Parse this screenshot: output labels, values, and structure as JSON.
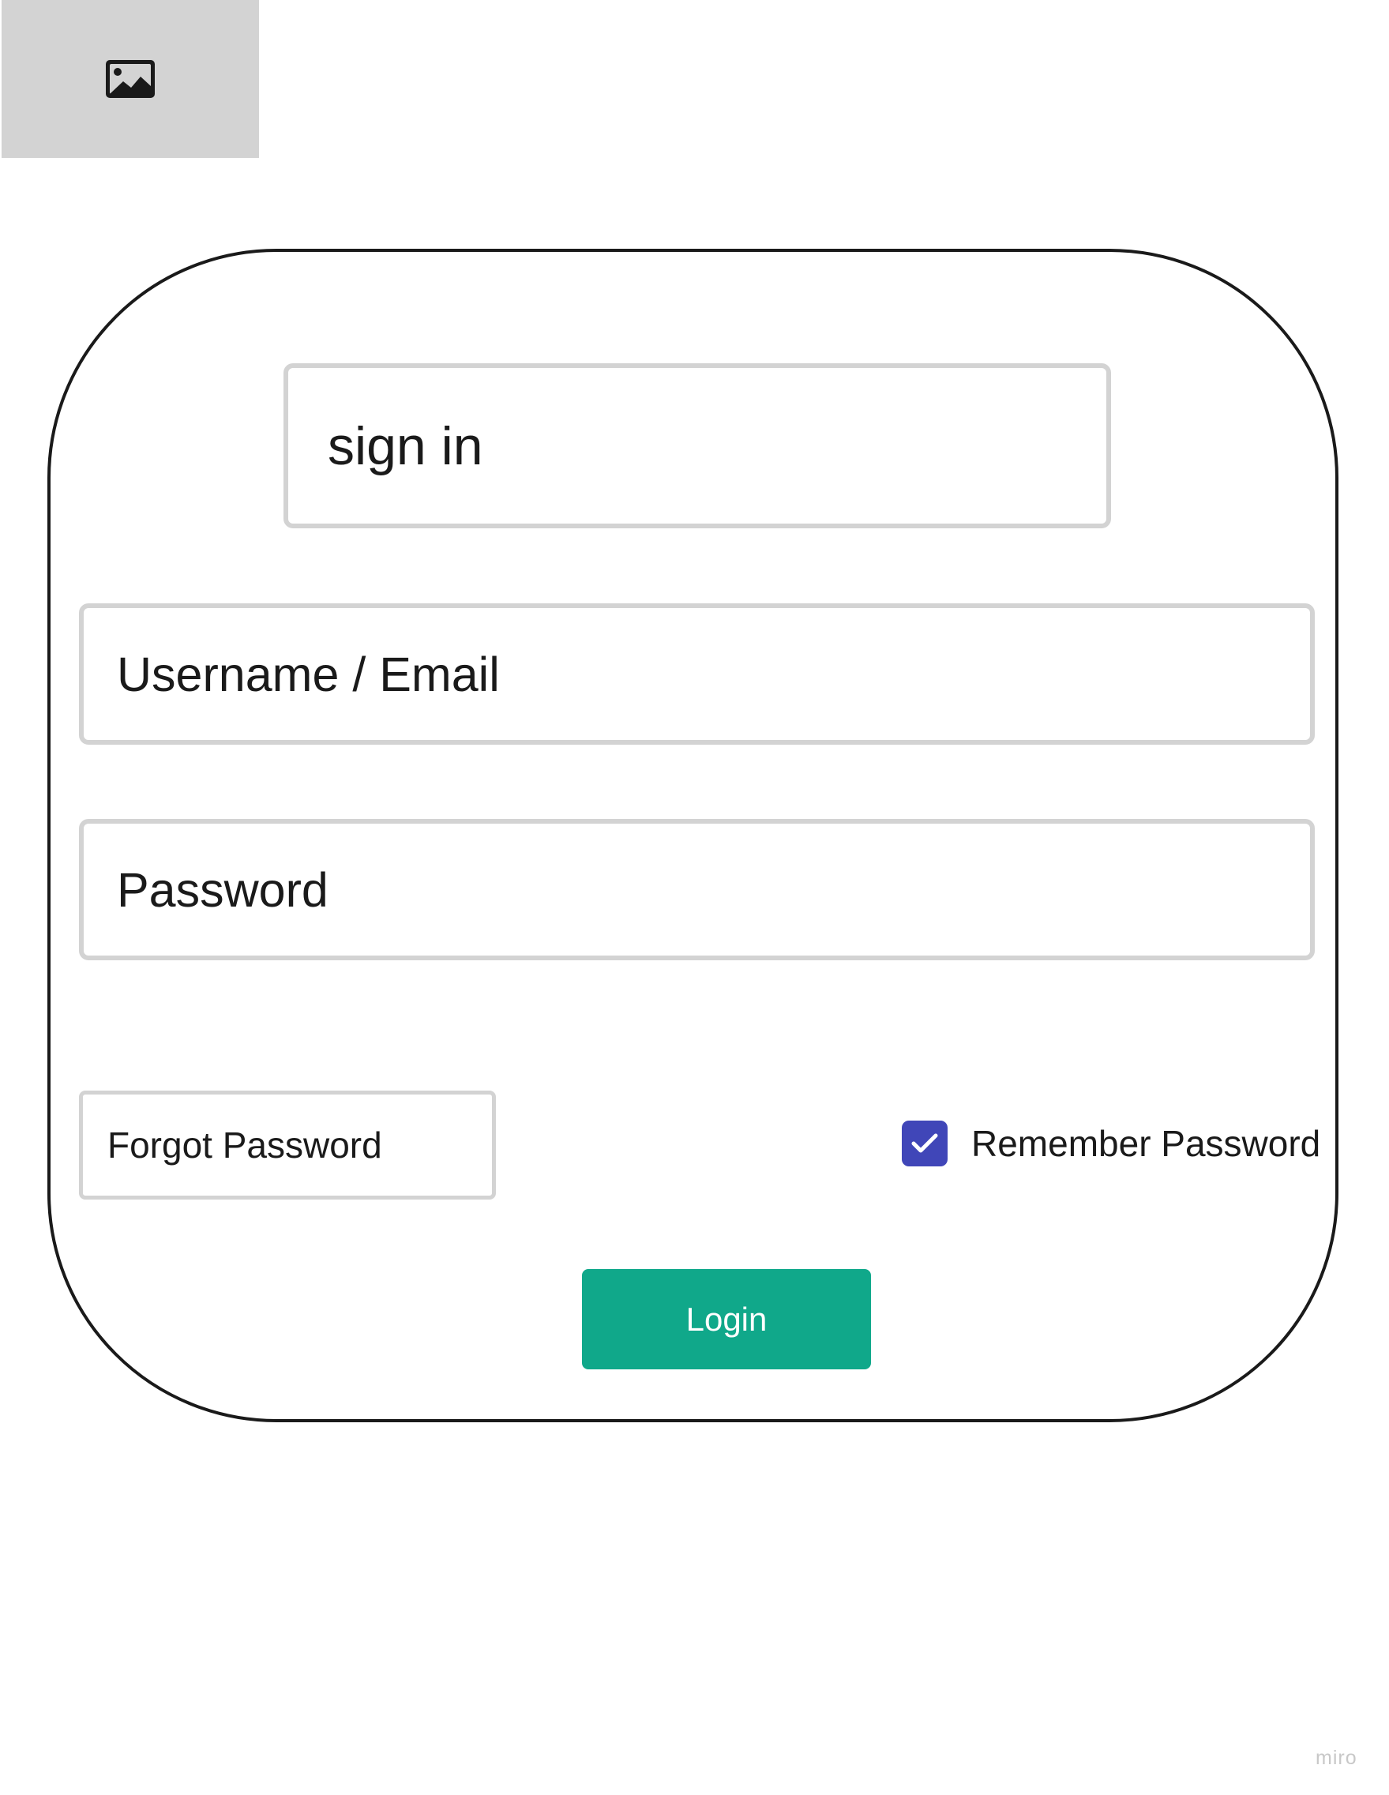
{
  "image_placeholder": {
    "icon": "image-icon"
  },
  "card": {
    "title": "sign in",
    "username_field": {
      "placeholder": "Username / Email"
    },
    "password_field": {
      "placeholder": "Password"
    },
    "forgot_password_label": "Forgot Password",
    "remember_password": {
      "label": "Remember Password",
      "checked": true
    },
    "login_label": "Login"
  },
  "watermark": "miro",
  "colors": {
    "card_border": "#1a1a1a",
    "field_border": "#d3d3d3",
    "placeholder_bg": "#d3d3d3",
    "checkbox": "#4046b8",
    "login_button": "#10a88a",
    "login_text": "#ffffff"
  }
}
